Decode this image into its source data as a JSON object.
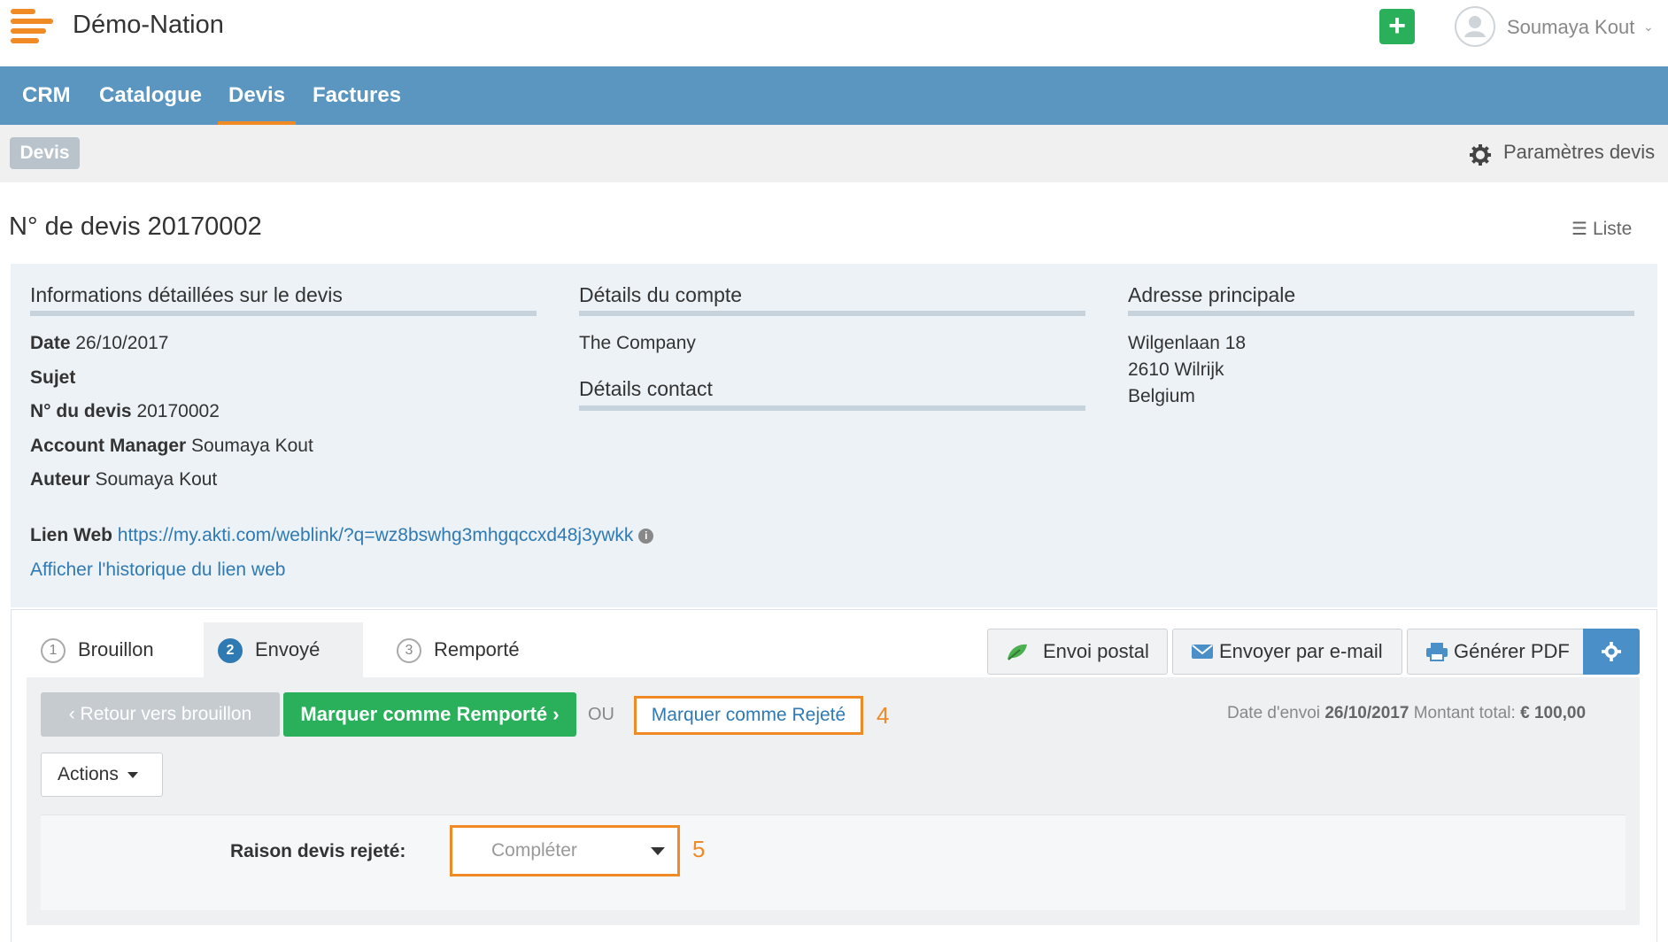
{
  "header": {
    "app_name": "Démo-Nation",
    "add_label": "+",
    "user_name": "Soumaya Kout"
  },
  "nav": {
    "items": [
      {
        "label": "CRM"
      },
      {
        "label": "Catalogue"
      },
      {
        "label": "Devis"
      },
      {
        "label": "Factures"
      }
    ],
    "active": "Devis"
  },
  "subbar": {
    "badge": "Devis",
    "settings_label": "Paramètres devis"
  },
  "page": {
    "title": "N° de devis 20170002",
    "list_label": "Liste"
  },
  "info": {
    "col1_title": "Informations détaillées sur le devis",
    "date_label": "Date",
    "date_value": "26/10/2017",
    "subject_label": "Sujet",
    "quote_no_label": "N° du devis",
    "quote_no_value": "20170002",
    "manager_label": "Account Manager",
    "manager_value": "Soumaya Kout",
    "author_label": "Auteur",
    "author_value": "Soumaya Kout",
    "weblink_label": "Lien Web",
    "weblink_value": "https://my.akti.com/weblink/?q=wz8bswhg3mhgqccxd48j3ywkk",
    "weblink_history": "Afficher l'historique du lien web",
    "col2_title": "Détails du compte",
    "company": "The Company",
    "contact_title": "Détails contact",
    "col3_title": "Adresse principale",
    "address_line1": "Wilgenlaan 18",
    "address_line2": "2610 Wilrijk",
    "address_line3": "Belgium"
  },
  "workflow": {
    "steps": [
      {
        "num": "1",
        "label": "Brouillon"
      },
      {
        "num": "2",
        "label": "Envoyé"
      },
      {
        "num": "3",
        "label": "Remporté"
      }
    ],
    "active_step": "Envoyé",
    "postal_label": "Envoi postal",
    "email_label": "Envoyer par e-mail",
    "pdf_label": "Générer PDF",
    "back_label": "‹ Retour vers brouillon",
    "won_label": "Marquer comme Remporté ›",
    "or_label": "OU",
    "reject_label": "Marquer comme Rejeté",
    "annotation_4": "4",
    "send_date_label": "Date d'envoi",
    "send_date_value": "26/10/2017",
    "total_label": "Montant total:",
    "total_value": "€ 100,00",
    "actions_label": "Actions",
    "reason_label": "Raison devis rejeté:",
    "reason_placeholder": "Compléter",
    "annotation_5": "5"
  },
  "colors": {
    "nav_blue": "#5b96c0",
    "accent_orange": "#f08a24",
    "green": "#2ab05a",
    "link_blue": "#2f7ab3"
  }
}
